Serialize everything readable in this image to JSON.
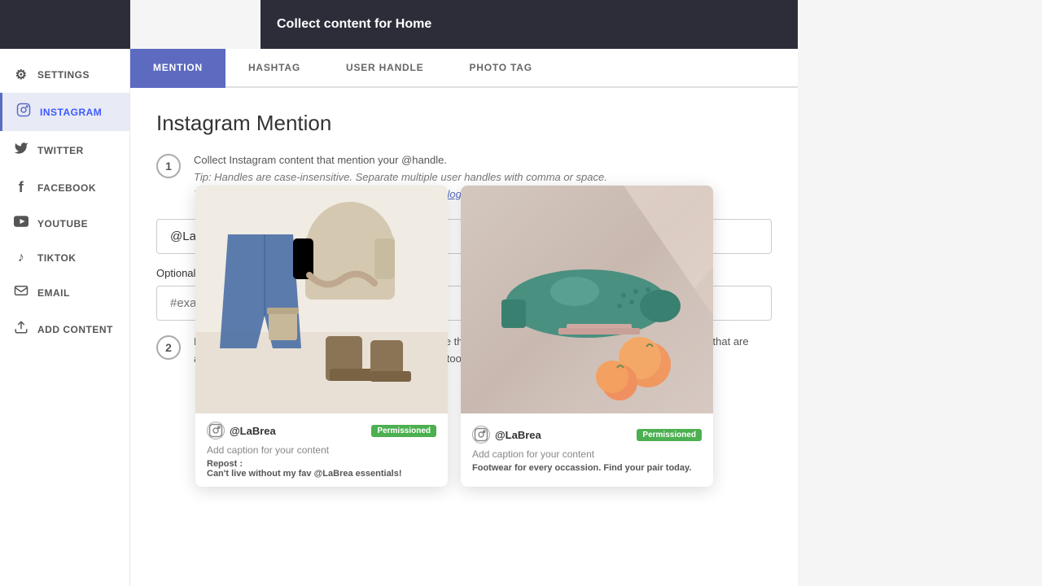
{
  "header": {
    "title": "Collect content for Home"
  },
  "sidebar": {
    "items": [
      {
        "id": "settings",
        "label": "SETTINGS",
        "icon": "⚙"
      },
      {
        "id": "instagram",
        "label": "INSTAGRAM",
        "icon": "📷",
        "active": true
      },
      {
        "id": "twitter",
        "label": "TWITTER",
        "icon": "🐦"
      },
      {
        "id": "facebook",
        "label": "FACEBOOK",
        "icon": "f"
      },
      {
        "id": "youtube",
        "label": "YOUTUBE",
        "icon": "▶"
      },
      {
        "id": "tiktok",
        "label": "TIKTOK",
        "icon": "♪"
      },
      {
        "id": "email",
        "label": "EMAIL",
        "icon": "✉"
      },
      {
        "id": "add-content",
        "label": "ADD CONTENT",
        "icon": "⬆"
      }
    ]
  },
  "tabs": [
    {
      "id": "mention",
      "label": "MENTION",
      "active": true
    },
    {
      "id": "hashtag",
      "label": "HASHTAG"
    },
    {
      "id": "user-handle",
      "label": "USER HANDLE"
    },
    {
      "id": "photo-tag",
      "label": "PHOTO TAG"
    }
  ],
  "content": {
    "title": "Instagram Mention",
    "step1": {
      "number": "1",
      "line1": "Collect Instagram content that mention your @handle.",
      "line2": "Tip: Handles are case-insensitive. Separate multiple user handles with comma or space.",
      "line3": "This feature is only available for",
      "link": "connected Instagram logins",
      "link_suffix": ".",
      "input_value": "@LaBrea",
      "optional_label": "Optional: A",
      "optional_placeholder": "#example"
    },
    "step2": {
      "number": "2",
      "text": "Me... for y... in y... Mea... the..."
    }
  },
  "cards": [
    {
      "username": "@LaBrea",
      "badge": "Permissioned",
      "caption_label": "Add caption for your content",
      "repost_label": "Repost :",
      "repost_text": "Can't live without my fav @LaBrea essentials!"
    },
    {
      "username": "@LaBrea",
      "badge": "Permissioned",
      "caption_label": "Add caption for your content",
      "repost_label": "",
      "repost_text": "Footwear for every occassion. Find your pair today."
    }
  ],
  "colors": {
    "accent": "#5c6bc0",
    "active_tab_bg": "#5c6bc0",
    "sidebar_active_bg": "#e8eaf6",
    "header_bg": "#2d2d3a",
    "permissioned": "#4caf50"
  }
}
